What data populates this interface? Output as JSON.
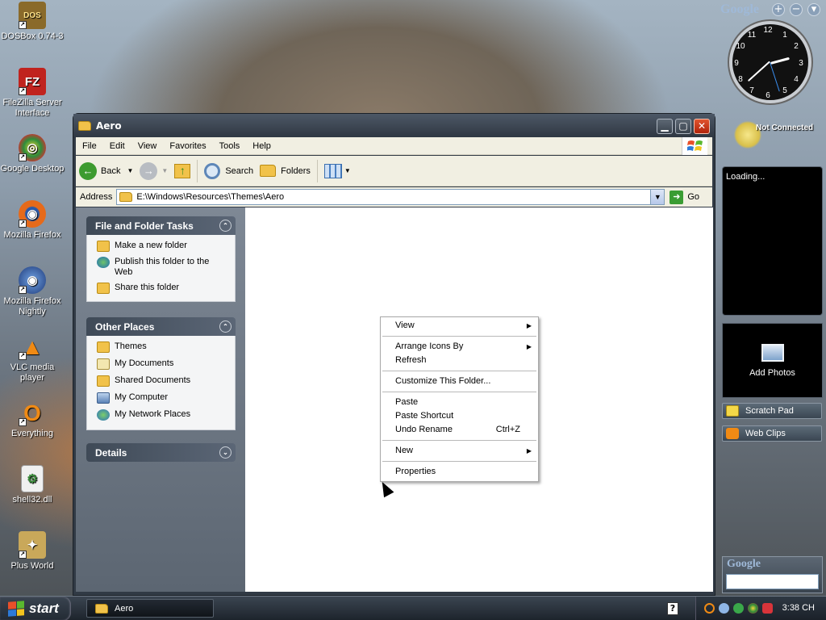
{
  "desktop": {
    "icons": [
      {
        "label": "DOSBox 0.74-3",
        "glyph": "DOS",
        "color": "#8a6a2a"
      },
      {
        "label": "FileZilla Server Interface",
        "glyph": "FZ",
        "color": "#c0231e"
      },
      {
        "label": "Google Desktop",
        "glyph": "◎",
        "color": "#2a6a3a"
      },
      {
        "label": "Mozilla Firefox",
        "glyph": "◉",
        "color": "#e66a1a"
      },
      {
        "label": "Mozilla Firefox Nightly",
        "glyph": "◉",
        "color": "#2b4a8a"
      },
      {
        "label": "VLC media player",
        "glyph": "▲",
        "color": "#e8820c"
      },
      {
        "label": "Everything",
        "glyph": "O",
        "color": "#e8820c"
      },
      {
        "label": "shell32.dll",
        "glyph": "⚙",
        "color": "#dcdcdc"
      },
      {
        "label": "Plus World",
        "glyph": "✦",
        "color": "#c9a85a"
      }
    ]
  },
  "window": {
    "title": "Aero",
    "menu": [
      "File",
      "Edit",
      "View",
      "Favorites",
      "Tools",
      "Help"
    ],
    "toolbar": {
      "back": "Back",
      "search": "Search",
      "folders": "Folders"
    },
    "address": {
      "label": "Address",
      "value": "E:\\Windows\\Resources\\Themes\\Aero",
      "go": "Go"
    },
    "tasks": {
      "file_folder_tasks": {
        "title": "File and Folder Tasks",
        "items": [
          "Make a new folder",
          "Publish this folder to the Web",
          "Share this folder"
        ]
      },
      "other_places": {
        "title": "Other Places",
        "items": [
          "Themes",
          "My Documents",
          "Shared Documents",
          "My Computer",
          "My Network Places"
        ]
      },
      "details": {
        "title": "Details"
      }
    }
  },
  "context_menu": {
    "view": "View",
    "arrange": "Arrange Icons By",
    "refresh": "Refresh",
    "customize": "Customize This Folder...",
    "paste": "Paste",
    "paste_shortcut": "Paste Shortcut",
    "undo_rename": "Undo Rename",
    "undo_shortcut": "Ctrl+Z",
    "new": "New",
    "properties": "Properties"
  },
  "sidebar": {
    "brand": "Google",
    "status": "Not Connected",
    "loading": "Loading...",
    "add_photos": "Add Photos",
    "scratch_pad": "Scratch Pad",
    "web_clips": "Web Clips",
    "search_brand": "Google"
  },
  "clock": {
    "numbers": [
      "12",
      "1",
      "2",
      "3",
      "4",
      "5",
      "6",
      "7",
      "8",
      "9",
      "10",
      "11"
    ],
    "time": "3:38"
  },
  "taskbar": {
    "start": "start",
    "task": "Aero",
    "clock": "3:38 CH"
  },
  "colors": {
    "accent": "#313a45",
    "context_bg": "#ffffff",
    "task_pane": "#5c6672"
  }
}
